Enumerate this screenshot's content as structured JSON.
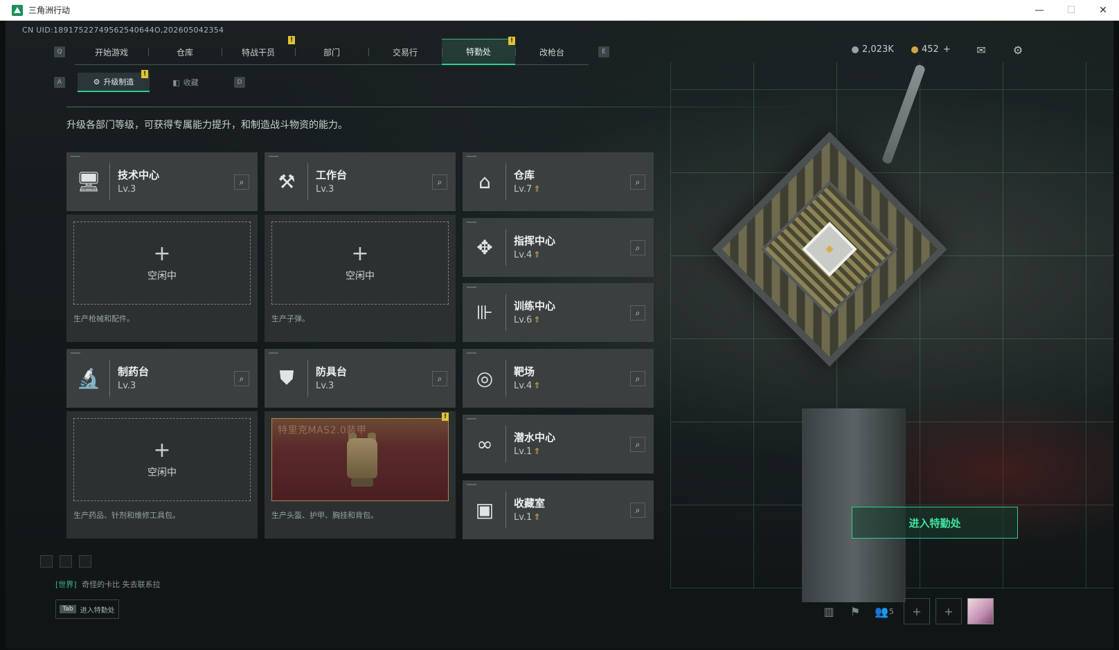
{
  "window": {
    "title": "三角洲行动",
    "controls": [
      "—",
      "☐",
      "✕"
    ]
  },
  "uid": "CN UID:18917522749562540644O,202605042354",
  "nav": {
    "left_key": "Q",
    "right_key": "E",
    "tabs": [
      {
        "label": "开始游戏"
      },
      {
        "label": "仓库"
      },
      {
        "label": "特战干员",
        "badge": "!"
      },
      {
        "label": "部门"
      },
      {
        "label": "交易行"
      },
      {
        "label": "特勤处",
        "badge": "!"
      },
      {
        "label": "改枪台"
      }
    ]
  },
  "currency": {
    "silver": "2,023K",
    "gold": "452",
    "gold_add": "+"
  },
  "subnav": {
    "left_key": "A",
    "right_key": "D",
    "tabs": [
      {
        "label": "升级制造",
        "badge": "!"
      },
      {
        "label": "收藏"
      }
    ]
  },
  "description": "升级各部门等级，可获得专属能力提升，和制造战斗物资的能力。",
  "facilities": [
    {
      "name": "技术中心",
      "level": "Lv.3",
      "icon": "monitor-icon",
      "upgrade": false
    },
    {
      "name": "工作台",
      "level": "Lv.3",
      "icon": "tools-icon",
      "upgrade": false
    },
    {
      "name": "仓库",
      "level": "Lv.7",
      "icon": "warehouse-icon",
      "upgrade": true
    },
    {
      "name": "指挥中心",
      "level": "Lv.4",
      "icon": "command-icon",
      "upgrade": true
    },
    {
      "name": "训练中心",
      "level": "Lv.6",
      "icon": "dumbbell-icon",
      "upgrade": true
    },
    {
      "name": "制药台",
      "level": "Lv.3",
      "icon": "microscope-icon",
      "upgrade": false
    },
    {
      "name": "防具台",
      "level": "Lv.3",
      "icon": "armor-icon",
      "upgrade": false
    },
    {
      "name": "靶场",
      "level": "Lv.4",
      "icon": "target-icon",
      "upgrade": true
    },
    {
      "name": "潜水中心",
      "level": "Lv.1",
      "icon": "diving-mask-icon",
      "upgrade": true
    },
    {
      "name": "收藏室",
      "level": "Lv.1",
      "icon": "collection-icon",
      "upgrade": true
    }
  ],
  "slots": {
    "idle_label": "空闲中",
    "plus": "+",
    "tech": {
      "caption": "生产枪械和配件。"
    },
    "workbench": {
      "caption": "生产子弹。"
    },
    "pharmacy": {
      "caption": "生产药品、针剂和维修工具包。"
    },
    "armory": {
      "caption": "生产头盔、护甲、胸挂和背包。",
      "item": "特里克MAS2.0装甲",
      "badge": "!"
    }
  },
  "enter_button": "进入特勤处",
  "chat": {
    "channel": "[世界]",
    "message": "奇怪的卡比  失去联系拉"
  },
  "tab_hint": {
    "key": "Tab",
    "label": "进入特勤处"
  },
  "friends_count": "5"
}
